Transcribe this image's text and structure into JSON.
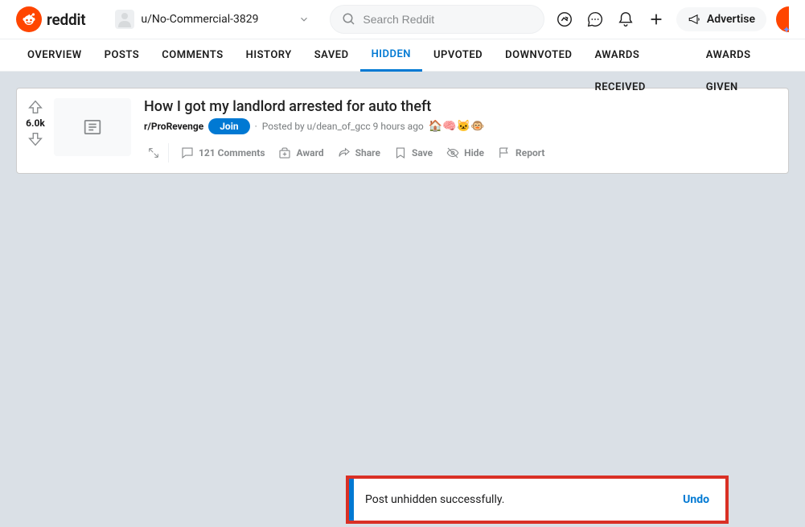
{
  "header": {
    "brand": "reddit",
    "username": "u/No-Commercial-3829",
    "search_placeholder": "Search Reddit",
    "advertise_label": "Advertise"
  },
  "tabs": [
    {
      "id": "overview",
      "label": "OVERVIEW"
    },
    {
      "id": "posts",
      "label": "POSTS"
    },
    {
      "id": "comments",
      "label": "COMMENTS"
    },
    {
      "id": "history",
      "label": "HISTORY"
    },
    {
      "id": "saved",
      "label": "SAVED"
    },
    {
      "id": "hidden",
      "label": "HIDDEN",
      "active": true
    },
    {
      "id": "upvoted",
      "label": "UPVOTED"
    },
    {
      "id": "downvoted",
      "label": "DOWNVOTED"
    },
    {
      "id": "awards_received",
      "label": "AWARDS RECEIVED"
    },
    {
      "id": "awards_given",
      "label": "AWARDS GIVEN"
    }
  ],
  "post": {
    "votes": "6.0k",
    "title": "How I got my landlord arrested for auto theft",
    "subreddit": "r/ProRevenge",
    "join_label": "Join",
    "posted_by_prefix": "Posted by ",
    "author": "u/dean_of_gcc",
    "age": "9 hours ago",
    "awards": [
      "🏠",
      "🧠",
      "🐱",
      "🐵"
    ],
    "actions": {
      "comments": "121 Comments",
      "award": "Award",
      "share": "Share",
      "save": "Save",
      "hide": "Hide",
      "report": "Report"
    }
  },
  "toast": {
    "message": "Post unhidden successfully.",
    "action": "Undo"
  }
}
